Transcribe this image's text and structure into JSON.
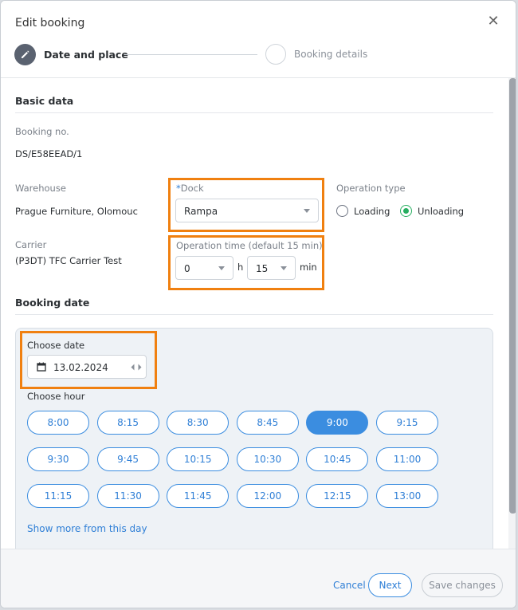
{
  "header": {
    "title": "Edit booking",
    "close_icon": "close-icon",
    "steps": [
      {
        "label": "Date and place",
        "icon": "pencil-icon",
        "state": "active"
      },
      {
        "label": "Booking details",
        "state": "inactive"
      }
    ]
  },
  "basic_data": {
    "title": "Basic data",
    "booking_no_label": "Booking no.",
    "booking_no_value": "DS/E58EEAD/1",
    "warehouse_label": "Warehouse",
    "warehouse_value": "Prague Furniture, Olomouc",
    "dock_required_mark": "*",
    "dock_label": "Dock",
    "dock_value": "Rampa",
    "operation_type_label": "Operation type",
    "operation_types": [
      {
        "label": "Loading",
        "checked": false
      },
      {
        "label": "Unloading",
        "checked": true
      }
    ],
    "carrier_label": "Carrier",
    "carrier_value": "(P3DT) TFC Carrier Test",
    "operation_time_label": "Operation time (default 15 min)",
    "hours_value": "0",
    "hours_unit": "h",
    "minutes_value": "15",
    "minutes_unit": "min"
  },
  "booking_date": {
    "title": "Booking date",
    "choose_date_label": "Choose date",
    "date_value": "13.02.2024",
    "choose_hour_label": "Choose hour",
    "hours": [
      "8:00",
      "8:15",
      "8:30",
      "8:45",
      "9:00",
      "9:15",
      "9:30",
      "9:45",
      "10:15",
      "10:30",
      "10:45",
      "11:00",
      "11:15",
      "11:30",
      "11:45",
      "12:00",
      "12:15",
      "13:00"
    ],
    "selected_hour": "9:00",
    "show_more_link": "Show more from this day"
  },
  "footer": {
    "cancel_label": "Cancel",
    "next_label": "Next",
    "save_label": "Save changes"
  },
  "colors": {
    "accent": "#3b8de0",
    "highlight": "#f08010",
    "radio_checked": "#27ae60"
  }
}
